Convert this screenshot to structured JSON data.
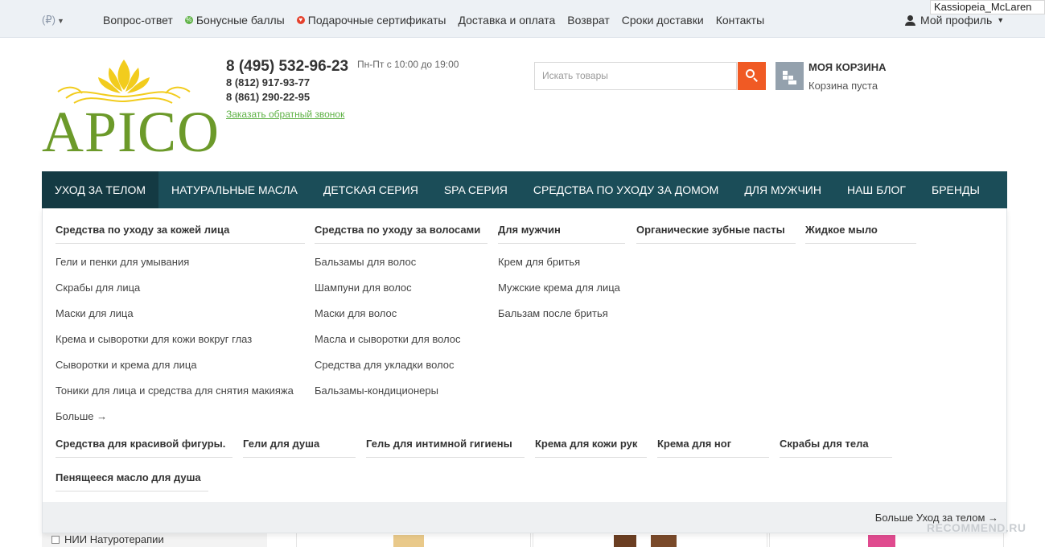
{
  "topbar": {
    "currency": "(₽)",
    "links": [
      "Вопрос-ответ",
      "Бонусные баллы",
      "Подарочные сертификаты",
      "Доставка и оплата",
      "Возврат",
      "Сроки доставки",
      "Контакты"
    ],
    "profile_label": "Мой профиль",
    "watermark_user": "Kassiopeia_McLaren"
  },
  "header": {
    "logo_text": "APICO",
    "phone_main": "8 (495) 532-96-23",
    "hours": "Пн-Пт с 10:00 до 19:00",
    "phone2": "8 (812) 917-93-77",
    "phone3": "8 (861) 290-22-95",
    "callback": "Заказать обратный звонок",
    "search_placeholder": "Искать товары",
    "cart_title": "МОЯ КОРЗИНА",
    "cart_status": "Корзина пуста"
  },
  "nav": {
    "items": [
      "УХОД ЗА ТЕЛОМ",
      "НАТУРАЛЬНЫЕ МАСЛА",
      "ДЕТСКАЯ СЕРИЯ",
      "SPA СЕРИЯ",
      "СРЕДСТВА ПО УХОДУ ЗА ДОМОМ",
      "ДЛЯ МУЖЧИН",
      "НАШ БЛОГ",
      "БРЕНДЫ"
    ]
  },
  "dropdown": {
    "face": {
      "title": "Средства по уходу за кожей лица",
      "links": [
        "Гели и пенки для умывания",
        "Скрабы для лица",
        "Маски для лица",
        "Крема и сыворотки для кожи вокруг глаз",
        "Сыворотки и крема для лица",
        "Тоники для лица и средства для снятия макияжа"
      ],
      "more": "Больше →"
    },
    "hair": {
      "title": "Средства по уходу за волосами",
      "links": [
        "Бальзамы для волос",
        "Шампуни для волос",
        "Маски для волос",
        "Масла и сыворотки для волос",
        "Средства для укладки волос",
        "Бальзамы-кондиционеры"
      ]
    },
    "men": {
      "title": "Для мужчин",
      "links": [
        "Крем для бритья",
        "Мужские крема для лица",
        "Бальзам после бритья"
      ]
    },
    "toothpaste": {
      "title": "Органические зубные пасты"
    },
    "soap": {
      "title": "Жидкое мыло"
    },
    "row2": [
      "Средства для красивой фигуры.",
      "Гели для душа",
      "Гель для интимной гигиены",
      "Крема для кожи рук",
      "Крема для ног",
      "Скрабы для тела"
    ],
    "row3": [
      "Пенящееся масло для душа"
    ],
    "footer_more": "Больше Уход за телом →"
  },
  "background": {
    "sidebar_item": "НИИ Натуротерапии",
    "watermark": "RECOMMEND.RU"
  }
}
